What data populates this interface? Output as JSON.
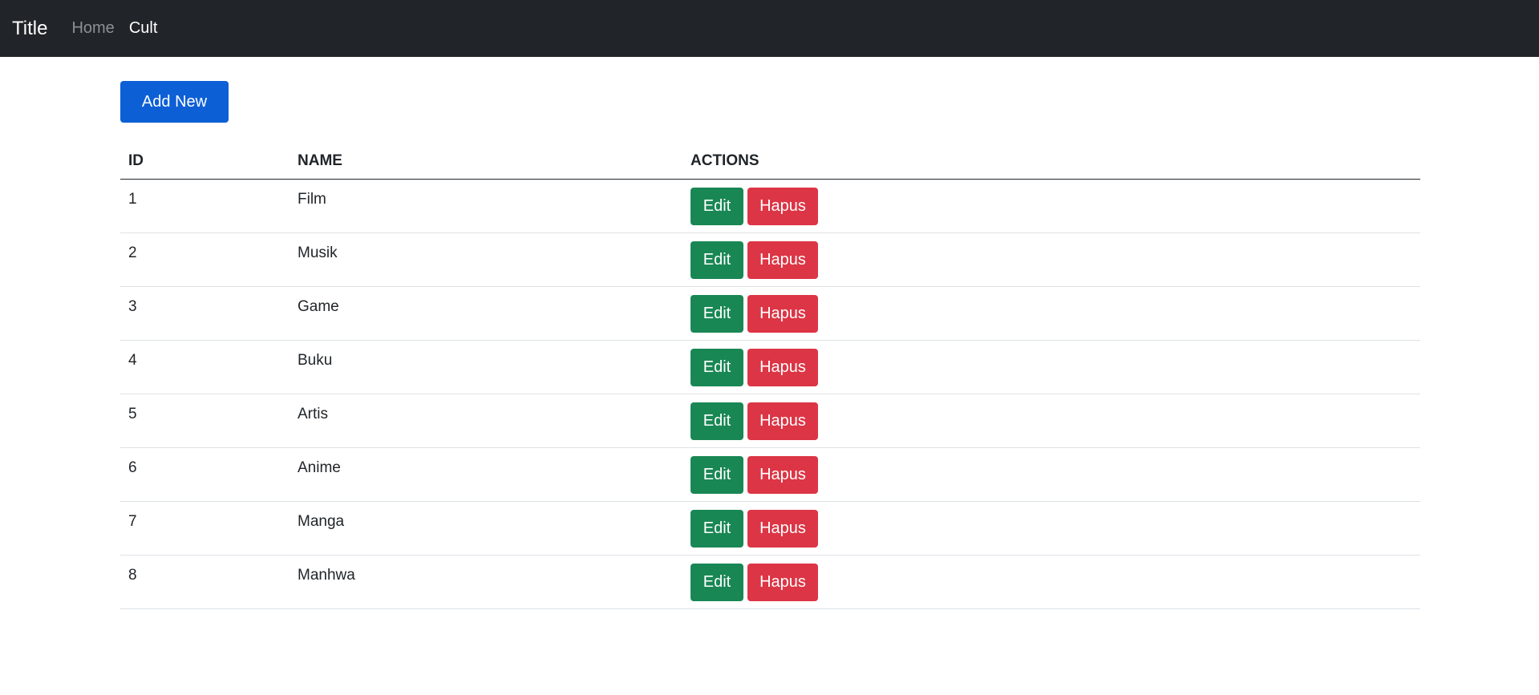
{
  "navbar": {
    "brand": "Title",
    "links": [
      {
        "label": "Home",
        "active": false
      },
      {
        "label": "Cult",
        "active": true
      }
    ]
  },
  "main": {
    "add_button_label": "Add New",
    "table": {
      "headers": [
        "ID",
        "NAME",
        "ACTIONS"
      ],
      "edit_label": "Edit",
      "delete_label": "Hapus",
      "rows": [
        {
          "id": "1",
          "name": "Film"
        },
        {
          "id": "2",
          "name": "Musik"
        },
        {
          "id": "3",
          "name": "Game"
        },
        {
          "id": "4",
          "name": "Buku"
        },
        {
          "id": "5",
          "name": "Artis"
        },
        {
          "id": "6",
          "name": "Anime"
        },
        {
          "id": "7",
          "name": "Manga"
        },
        {
          "id": "8",
          "name": "Manhwa"
        }
      ]
    }
  },
  "colors": {
    "navbar_bg": "#212529",
    "primary": "#0d5fd6",
    "success": "#198754",
    "danger": "#dc3545"
  }
}
